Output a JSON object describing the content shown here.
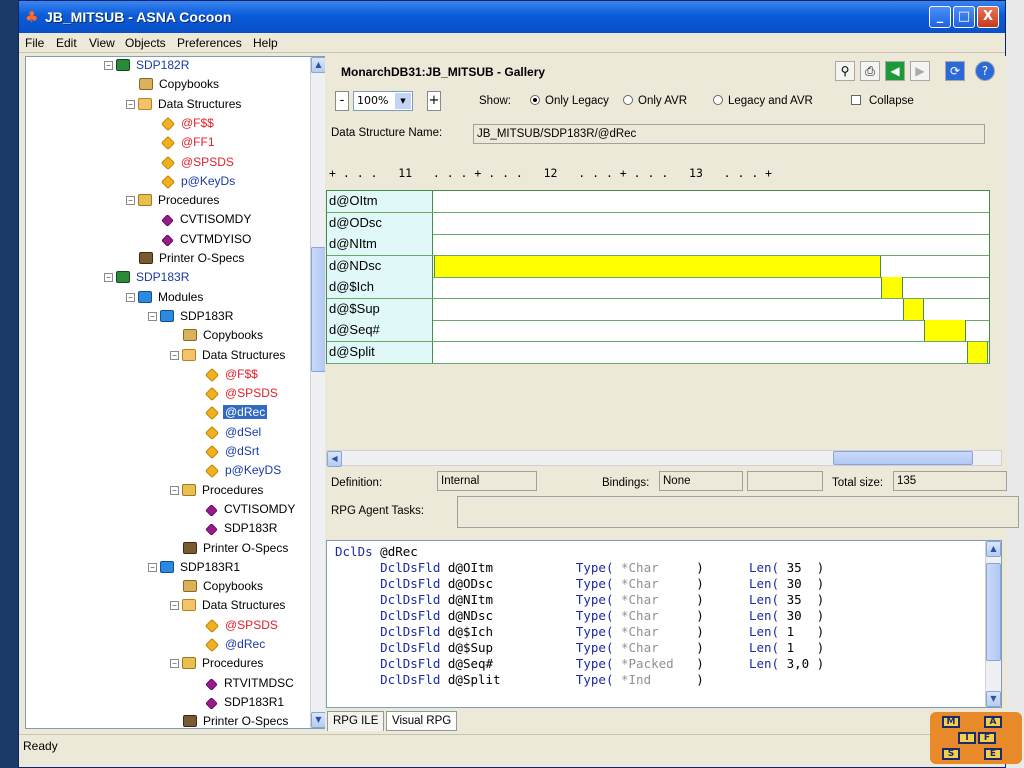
{
  "window": {
    "title": "JB_MITSUB - ASNA Cocoon",
    "minimize_label": "_",
    "maximize_label": "□",
    "close_label": "X"
  },
  "menu": [
    "File",
    "Edit",
    "View",
    "Objects",
    "Preferences",
    "Help"
  ],
  "tree": {
    "items": [
      {
        "label": "SDP182R",
        "color": "blue",
        "icon": "program-icon"
      },
      {
        "label": "Copybooks",
        "color": "black",
        "icon": "copybook-icon"
      },
      {
        "label": "Data Structures",
        "color": "black",
        "icon": "data-structures-icon"
      },
      {
        "label": "@F$$",
        "color": "red",
        "icon": "ds-diamond-icon"
      },
      {
        "label": "@FF1",
        "color": "red",
        "icon": "ds-diamond-icon"
      },
      {
        "label": "@SPSDS",
        "color": "red",
        "icon": "ds-diamond-icon"
      },
      {
        "label": "p@KeyDs",
        "color": "blue",
        "icon": "ds-diamond-icon"
      },
      {
        "label": "Procedures",
        "color": "black",
        "icon": "procedures-icon"
      },
      {
        "label": "CVTISOMDY",
        "color": "black",
        "icon": "procedure-icon"
      },
      {
        "label": "CVTMDYISO",
        "color": "black",
        "icon": "procedure-icon"
      },
      {
        "label": "Printer O-Specs",
        "color": "black",
        "icon": "printer-icon"
      },
      {
        "label": "SDP183R",
        "color": "blue",
        "icon": "program-icon"
      },
      {
        "label": "Modules",
        "color": "black",
        "icon": "modules-icon"
      },
      {
        "label": "SDP183R",
        "color": "black",
        "icon": "module-icon"
      },
      {
        "label": "Copybooks",
        "color": "black",
        "icon": "copybook-icon"
      },
      {
        "label": "Data Structures",
        "color": "black",
        "icon": "data-structures-icon"
      },
      {
        "label": "@F$$",
        "color": "red",
        "icon": "ds-diamond-icon"
      },
      {
        "label": "@SPSDS",
        "color": "red",
        "icon": "ds-diamond-icon"
      },
      {
        "label": "@dRec",
        "color": "selected",
        "icon": "ds-diamond-icon"
      },
      {
        "label": "@dSel",
        "color": "blue",
        "icon": "ds-diamond-icon"
      },
      {
        "label": "@dSrt",
        "color": "blue",
        "icon": "ds-diamond-icon"
      },
      {
        "label": "p@KeyDS",
        "color": "blue",
        "icon": "ds-diamond-icon"
      },
      {
        "label": "Procedures",
        "color": "black",
        "icon": "procedures-icon"
      },
      {
        "label": "CVTISOMDY",
        "color": "black",
        "icon": "procedure-icon"
      },
      {
        "label": "SDP183R",
        "color": "black",
        "icon": "procedure-icon"
      },
      {
        "label": "Printer O-Specs",
        "color": "black",
        "icon": "printer-icon"
      },
      {
        "label": "SDP183R1",
        "color": "black",
        "icon": "module-icon"
      },
      {
        "label": "Copybooks",
        "color": "black",
        "icon": "copybook-icon"
      },
      {
        "label": "Data Structures",
        "color": "black",
        "icon": "data-structures-icon"
      },
      {
        "label": "@SPSDS",
        "color": "red",
        "icon": "ds-diamond-icon"
      },
      {
        "label": "@dRec",
        "color": "blue",
        "icon": "ds-diamond-icon"
      },
      {
        "label": "Procedures",
        "color": "black",
        "icon": "procedures-icon"
      },
      {
        "label": "RTVITMDSC",
        "color": "black",
        "icon": "procedure-icon"
      },
      {
        "label": "SDP183R1",
        "color": "black",
        "icon": "procedure-icon"
      },
      {
        "label": "Printer O-Specs",
        "color": "black",
        "icon": "printer-icon"
      }
    ]
  },
  "gallery": {
    "title": "MonarchDB31:JB_MITSUB - Gallery",
    "zoom": "100%",
    "zoom_minus": "-",
    "zoom_plus": "+",
    "show_label": "Show:",
    "options": [
      "Only Legacy",
      "Only AVR",
      "Legacy and AVR"
    ],
    "selected_option": "Only Legacy",
    "collapse_label": "Collapse",
    "ds_name_label": "Data Structure Name:",
    "ds_name_value": "JB_MITSUB/SDP183R/@dRec",
    "ruler": "+ . . .   11   . . . + . . .   12   . . . + . . .   13   . . . +",
    "fields": [
      {
        "name": "d@OItm",
        "start": 0,
        "len": 0
      },
      {
        "name": "d@ODsc",
        "start": 0,
        "len": 0
      },
      {
        "name": "d@NItm",
        "start": 0,
        "len": 0
      },
      {
        "name": "d@NDsc",
        "start": 0,
        "len": 21
      },
      {
        "name": "d@$Ich",
        "start": 21,
        "len": 1
      },
      {
        "name": "d@$Sup",
        "start": 22,
        "len": 1
      },
      {
        "name": "d@Seq#",
        "start": 23,
        "len": 2
      },
      {
        "name": "d@Split",
        "start": 25,
        "len": 1
      }
    ]
  },
  "details": {
    "definition_label": "Definition:",
    "definition_value": "Internal",
    "bindings_label": "Bindings:",
    "bindings_value": "None",
    "total_size_label": "Total size:",
    "total_size_value": "135",
    "agent_tasks_label": "RPG Agent Tasks:"
  },
  "code": {
    "header": {
      "kw": "DclDs",
      "name": "@dRec"
    },
    "lines": [
      {
        "kw": "DclDsFld",
        "name": "d@OItm",
        "type": "*Char",
        "len": "35"
      },
      {
        "kw": "DclDsFld",
        "name": "d@ODsc",
        "type": "*Char",
        "len": "30"
      },
      {
        "kw": "DclDsFld",
        "name": "d@NItm",
        "type": "*Char",
        "len": "35"
      },
      {
        "kw": "DclDsFld",
        "name": "d@NDsc",
        "type": "*Char",
        "len": "30"
      },
      {
        "kw": "DclDsFld",
        "name": "d@$Ich",
        "type": "*Char",
        "len": "1"
      },
      {
        "kw": "DclDsFld",
        "name": "d@$Sup",
        "type": "*Char",
        "len": "1"
      },
      {
        "kw": "DclDsFld",
        "name": "d@Seq#",
        "type": "*Packed",
        "len": "3,0"
      },
      {
        "kw": "DclDsFld",
        "name": "d@Split",
        "type": "*Ind",
        "len": ""
      }
    ],
    "type_kw": "Type(",
    "len_kw": "Len("
  },
  "tabs": [
    "RPG ILE",
    "Visual RPG"
  ],
  "status": "Ready",
  "logo": {
    "letters": [
      "M",
      "A",
      "I",
      "F",
      "S",
      "E"
    ]
  },
  "colors": {
    "bar": "#ffff00",
    "name_cell": "#e0f8f8",
    "selected": "#316ac5"
  }
}
